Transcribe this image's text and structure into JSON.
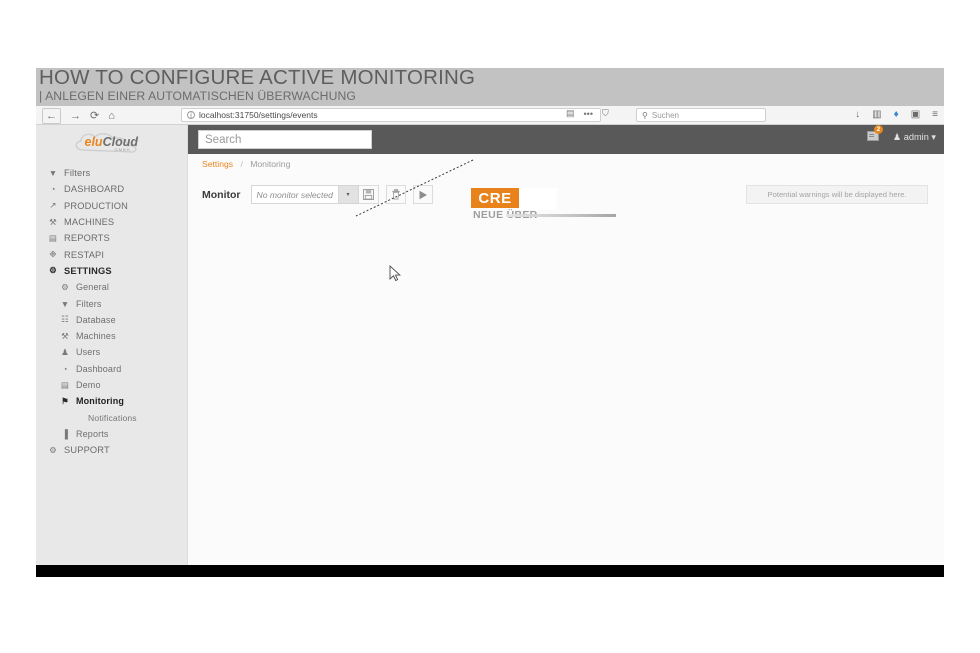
{
  "slide": {
    "title_main": "HOW TO CONFIGURE ACTIVE MONITORING",
    "title_sub": "| ANLEGEN EINER AUTOMATISCHEN ÜBERWACHUNG"
  },
  "browser": {
    "back_icon": "←",
    "forward_icon": "→",
    "reload_icon": "⟳",
    "home_icon": "⌂",
    "info_icon": "i",
    "url": "localhost:31750/settings/events",
    "reader_icon": "▤",
    "more_icon": "•••",
    "shield_icon": "⛉",
    "search_icon": "⚲",
    "search_placeholder": "Suchen",
    "downloads_icon": "↓",
    "library_icon": "▥",
    "sync_icon": "♦",
    "sidebar_icon": "▣",
    "menu_icon": "≡"
  },
  "sidebar": {
    "logo": {
      "part1": "elu",
      "part2": "Cloud",
      "sub": "GMBH"
    },
    "items": [
      {
        "label": "Filters",
        "icon": "▼",
        "icon_name": "filter-icon",
        "level": "top",
        "active": false
      },
      {
        "label": "DASHBOARD",
        "icon": "◔",
        "icon_name": "dashboard-icon",
        "level": "top",
        "active": false
      },
      {
        "label": "PRODUCTION",
        "icon": "↗",
        "icon_name": "chart-line-icon",
        "level": "top",
        "active": false
      },
      {
        "label": "MACHINES",
        "icon": "⚒",
        "icon_name": "machines-icon",
        "level": "top",
        "active": false
      },
      {
        "label": "REPORTS",
        "icon": "▤",
        "icon_name": "reports-icon",
        "level": "top",
        "active": false
      },
      {
        "label": "RESTAPI",
        "icon": "❉",
        "icon_name": "restapi-icon",
        "level": "top",
        "active": false
      },
      {
        "label": "SETTINGS",
        "icon": "⚙",
        "icon_name": "gear-icon",
        "level": "top",
        "active": true
      },
      {
        "label": "General",
        "icon": "⚙",
        "icon_name": "gear-icon",
        "level": "sub",
        "active": false
      },
      {
        "label": "Filters",
        "icon": "▼",
        "icon_name": "filter-icon",
        "level": "sub",
        "active": false
      },
      {
        "label": "Database",
        "icon": "☷",
        "icon_name": "database-icon",
        "level": "sub",
        "active": false
      },
      {
        "label": "Machines",
        "icon": "⚒",
        "icon_name": "machines-icon",
        "level": "sub",
        "active": false
      },
      {
        "label": "Users",
        "icon": "♟",
        "icon_name": "user-icon",
        "level": "sub",
        "active": false
      },
      {
        "label": "Dashboard",
        "icon": "◔",
        "icon_name": "dashboard-icon",
        "level": "sub",
        "active": false
      },
      {
        "label": "Demo",
        "icon": "▤",
        "icon_name": "demo-icon",
        "level": "sub",
        "active": false
      },
      {
        "label": "Monitoring",
        "icon": "⚑",
        "icon_name": "bell-icon",
        "level": "sub",
        "active": true
      },
      {
        "label": "Notifications",
        "icon": "",
        "icon_name": "notifications-icon",
        "level": "subsub",
        "active": false
      },
      {
        "label": "Reports",
        "icon": "▐",
        "icon_name": "bar-chart-icon",
        "level": "sub",
        "active": false
      },
      {
        "label": "SUPPORT",
        "icon": "⚙",
        "icon_name": "support-icon",
        "level": "top",
        "active": false
      }
    ]
  },
  "topbar": {
    "search_placeholder": "Search",
    "search_value": "",
    "message_icon": "✉",
    "message_badge": "2",
    "user_icon": "♟",
    "user_label": "admin",
    "user_caret": "▾"
  },
  "breadcrumb": {
    "parent": "Settings",
    "separator": "/",
    "current": "Monitoring"
  },
  "main": {
    "monitor_label": "Monitor",
    "monitor_select_value": "No monitor selected",
    "caret_icon": "▾",
    "buttons": [
      {
        "name": "save-button",
        "title": "Save"
      },
      {
        "name": "delete-button",
        "title": "Delete"
      },
      {
        "name": "run-button",
        "title": "Run"
      }
    ],
    "warning_text": "Potential warnings will be displayed here."
  },
  "annotation": {
    "badge_text": "CRE",
    "sub_text": "NEUE ÜBER",
    "accent_color": "#e8821a"
  }
}
